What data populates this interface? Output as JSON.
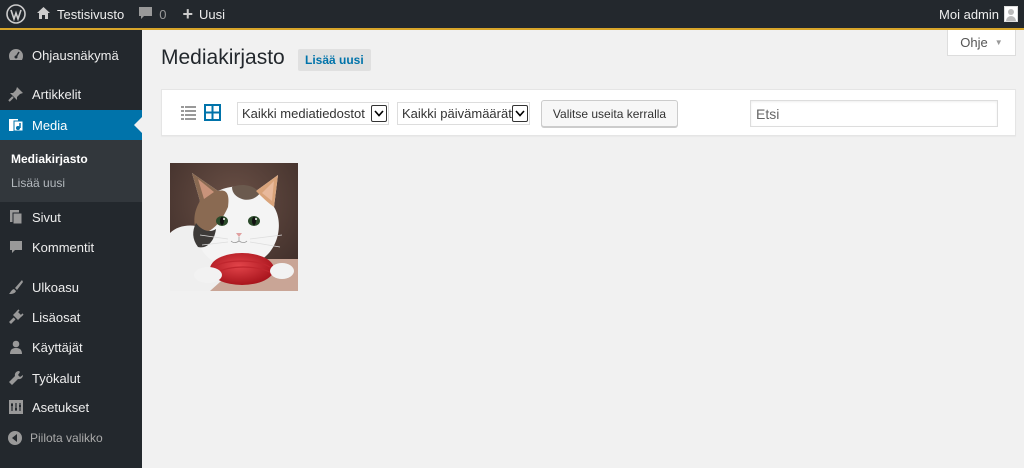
{
  "adminbar": {
    "site_name": "Testisivusto",
    "comments_count": "0",
    "new_label": "Uusi",
    "account_label": "Moi admin"
  },
  "sidebar": {
    "items": [
      {
        "label": "Ohjausnäkymä",
        "icon": "dashboard-icon"
      },
      {
        "label": "Artikkelit",
        "icon": "pin-icon"
      },
      {
        "label": "Media",
        "icon": "media-icon",
        "current": true
      },
      {
        "label": "Sivut",
        "icon": "pages-icon"
      },
      {
        "label": "Kommentit",
        "icon": "comments-icon"
      },
      {
        "label": "Ulkoasu",
        "icon": "brush-icon"
      },
      {
        "label": "Lisäosat",
        "icon": "plugin-icon"
      },
      {
        "label": "Käyttäjät",
        "icon": "users-icon"
      },
      {
        "label": "Työkalut",
        "icon": "wrench-icon"
      },
      {
        "label": "Asetukset",
        "icon": "settings-icon"
      }
    ],
    "submenu": [
      {
        "label": "Mediakirjasto",
        "current": true
      },
      {
        "label": "Lisää uusi"
      }
    ],
    "collapse_label": "Piilota valikko"
  },
  "help": {
    "label": "Ohje"
  },
  "page": {
    "title": "Mediakirjasto",
    "add_new_label": "Lisää uusi"
  },
  "toolbar": {
    "filter_type": {
      "selected": "Kaikki mediatiedostot"
    },
    "filter_date": {
      "selected": "Kaikki päivämäärät"
    },
    "bulk_select_label": "Valitse useita kerralla",
    "search_placeholder": "Etsi"
  },
  "colors": {
    "accent": "#0073aa",
    "adminbar_bg": "#23282d",
    "submenu_bg": "#32373c",
    "content_bg": "#f1f1f1"
  }
}
